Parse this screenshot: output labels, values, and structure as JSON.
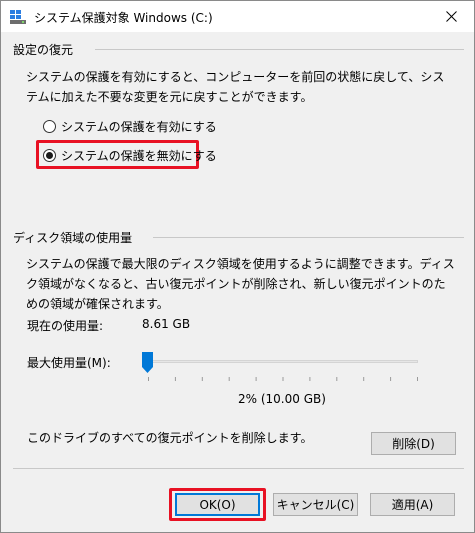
{
  "window": {
    "title": "システム保護対象 Windows (C:)"
  },
  "restore_settings": {
    "group_title": "設定の復元",
    "description": "システムの保護を有効にすると、コンピューターを前回の状態に戻して、システムに加えた不要な変更を元に戻すことができます。",
    "options": [
      {
        "label": "システムの保護を有効にする",
        "selected": false
      },
      {
        "label": "システムの保護を無効にする",
        "selected": true
      }
    ]
  },
  "disk_usage": {
    "group_title": "ディスク領域の使用量",
    "description": "システムの保護で最大限のディスク領域を使用するように調整できます。ディスク領域がなくなると、古い復元ポイントが削除され、新しい復元ポイントのための領域が確保されます。",
    "current_usage_label": "現在の使用量:",
    "current_usage_value": "8.61 GB",
    "max_usage_label": "最大使用量(M):",
    "max_usage_percent": 2,
    "max_usage_readout": "2% (10.00 GB)",
    "delete_description": "このドライブのすべての復元ポイントを削除します。",
    "delete_button": "削除(D)"
  },
  "footer": {
    "ok_button": "OK(O)",
    "cancel_button": "キャンセル(C)",
    "apply_button": "適用(A)"
  },
  "colors": {
    "highlight": "#e81123",
    "focus": "#0078d7",
    "slider_thumb": "#0078d7"
  }
}
